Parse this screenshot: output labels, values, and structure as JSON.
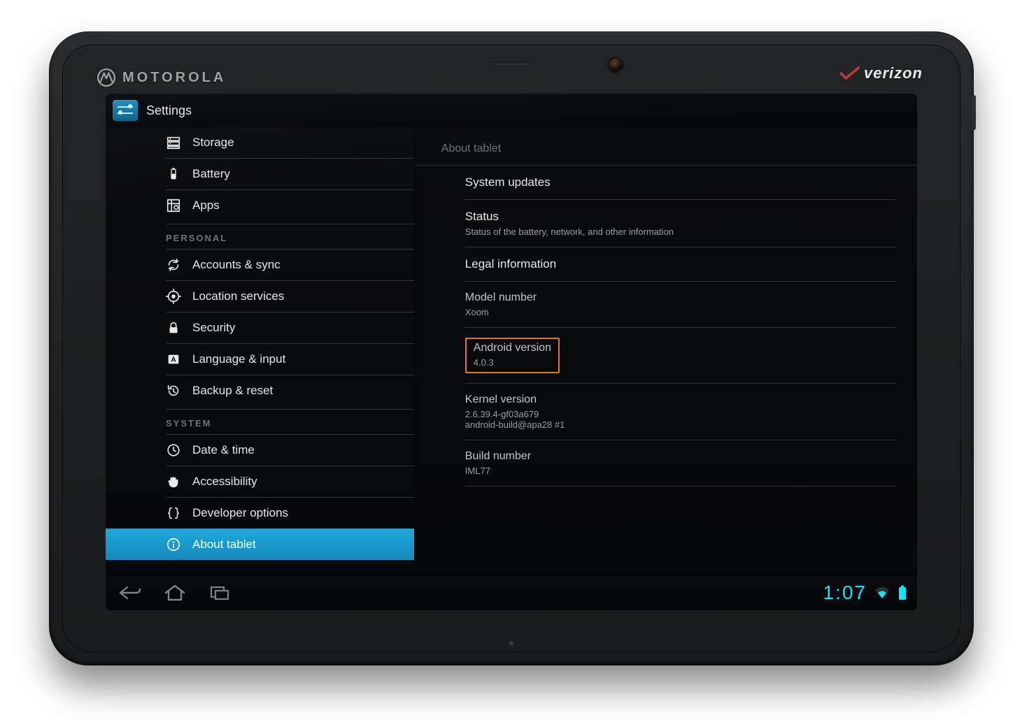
{
  "device": {
    "brand_left": "MOTOROLA",
    "brand_right": "verizon"
  },
  "app": {
    "title": "Settings"
  },
  "sidebar": {
    "sections": [
      {
        "header": null,
        "items": [
          {
            "id": "storage",
            "label": "Storage",
            "icon": "storage-icon"
          },
          {
            "id": "battery",
            "label": "Battery",
            "icon": "battery-icon"
          },
          {
            "id": "apps",
            "label": "Apps",
            "icon": "apps-icon"
          }
        ]
      },
      {
        "header": "PERSONAL",
        "items": [
          {
            "id": "accounts-sync",
            "label": "Accounts & sync",
            "icon": "sync-icon"
          },
          {
            "id": "location-services",
            "label": "Location services",
            "icon": "location-icon"
          },
          {
            "id": "security",
            "label": "Security",
            "icon": "lock-icon"
          },
          {
            "id": "language-input",
            "label": "Language & input",
            "icon": "language-icon"
          },
          {
            "id": "backup-reset",
            "label": "Backup & reset",
            "icon": "restore-icon"
          }
        ]
      },
      {
        "header": "SYSTEM",
        "items": [
          {
            "id": "date-time",
            "label": "Date & time",
            "icon": "clock-icon"
          },
          {
            "id": "accessibility",
            "label": "Accessibility",
            "icon": "hand-icon"
          },
          {
            "id": "developer-options",
            "label": "Developer options",
            "icon": "braces-icon"
          },
          {
            "id": "about-tablet",
            "label": "About tablet",
            "icon": "info-icon",
            "selected": true
          }
        ]
      }
    ]
  },
  "about": {
    "header": "About tablet",
    "items": [
      {
        "id": "system-updates",
        "title": "System updates",
        "subtitle": null,
        "interactable": true
      },
      {
        "id": "status",
        "title": "Status",
        "subtitle": "Status of the battery, network, and other information",
        "interactable": true
      },
      {
        "id": "legal-info",
        "title": "Legal information",
        "subtitle": null,
        "interactable": true
      },
      {
        "id": "model-number",
        "title": "Model number",
        "subtitle": "Xoom",
        "interactable": false,
        "dim": true
      },
      {
        "id": "android-version",
        "title": "Android version",
        "subtitle": "4.0.3",
        "interactable": false,
        "dim": true,
        "highlight": true
      },
      {
        "id": "kernel-version",
        "title": "Kernel version",
        "subtitle": "2.6.39.4-gf03a679\nandroid-build@apa28 #1",
        "interactable": false,
        "dim": true
      },
      {
        "id": "build-number",
        "title": "Build number",
        "subtitle": "IML77",
        "interactable": false,
        "dim": true
      }
    ]
  },
  "systembar": {
    "time": "1:07"
  }
}
